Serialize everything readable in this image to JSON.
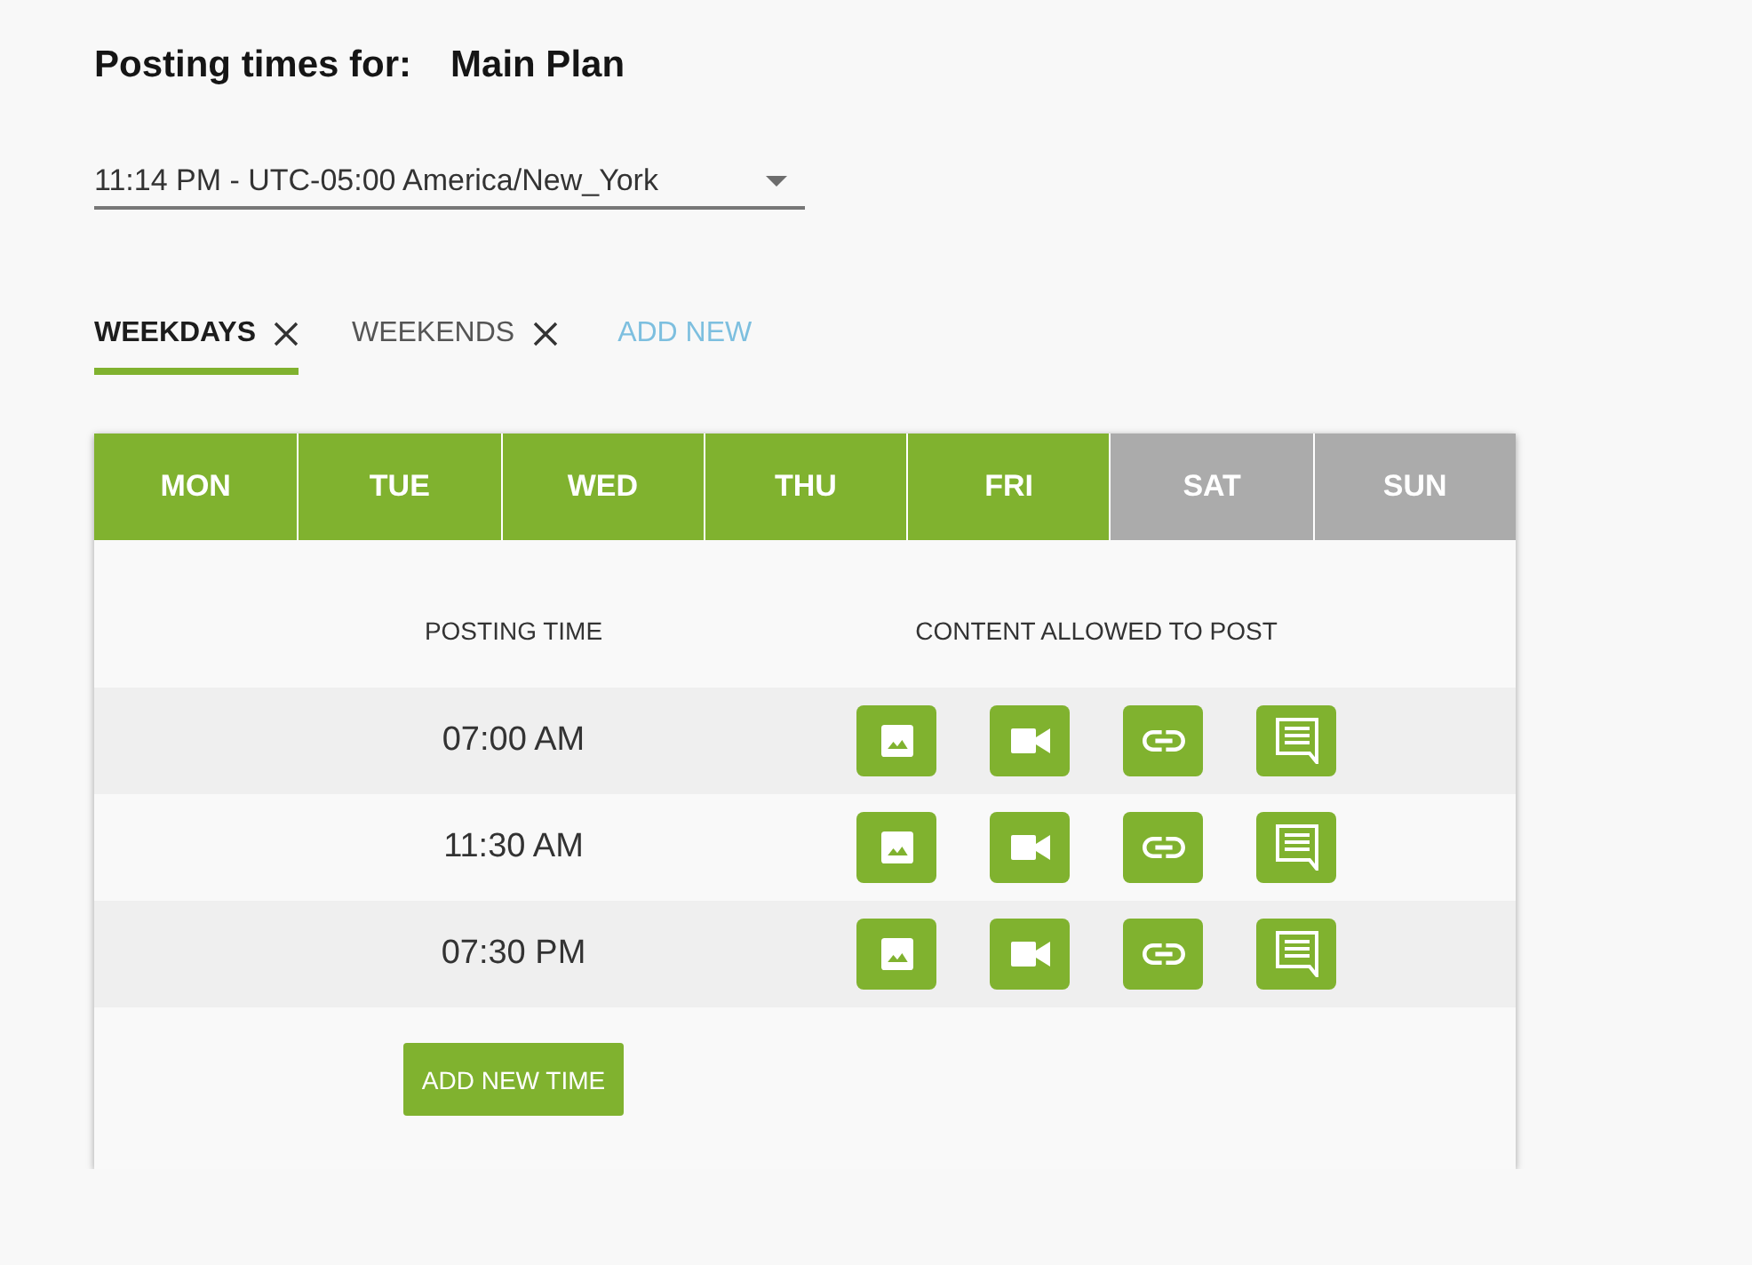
{
  "heading": {
    "label": "Posting times for:",
    "plan_name": "Main Plan"
  },
  "timezone_select": {
    "value": "11:14 PM - UTC-05:00 America/New_York"
  },
  "schedule_tabs": [
    {
      "label": "WEEKDAYS",
      "selected": true
    },
    {
      "label": "WEEKENDS",
      "selected": false
    }
  ],
  "add_schedule_link": {
    "label": "ADD NEW"
  },
  "days": [
    {
      "label": "MON",
      "selected": true
    },
    {
      "label": "TUE",
      "selected": true
    },
    {
      "label": "WED",
      "selected": true
    },
    {
      "label": "THU",
      "selected": true
    },
    {
      "label": "FRI",
      "selected": true
    },
    {
      "label": "SAT",
      "selected": false
    },
    {
      "label": "SUN",
      "selected": false
    }
  ],
  "table": {
    "columns": [
      "POSTING TIME",
      "CONTENT ALLOWED TO POST"
    ],
    "rows": [
      {
        "time": "07:00 AM",
        "content": [
          {
            "kind": "image",
            "on": true
          },
          {
            "kind": "video",
            "on": true
          },
          {
            "kind": "link",
            "on": true
          },
          {
            "kind": "text",
            "on": true
          }
        ]
      },
      {
        "time": "11:30 AM",
        "content": [
          {
            "kind": "image",
            "on": true
          },
          {
            "kind": "video",
            "on": true
          },
          {
            "kind": "link",
            "on": true
          },
          {
            "kind": "text",
            "on": true
          }
        ]
      },
      {
        "time": "07:30 PM",
        "content": [
          {
            "kind": "image",
            "on": true
          },
          {
            "kind": "video",
            "on": true
          },
          {
            "kind": "link",
            "on": true
          },
          {
            "kind": "text",
            "on": true
          }
        ]
      }
    ]
  },
  "add_time_button": {
    "label": "ADD NEW TIME"
  }
}
